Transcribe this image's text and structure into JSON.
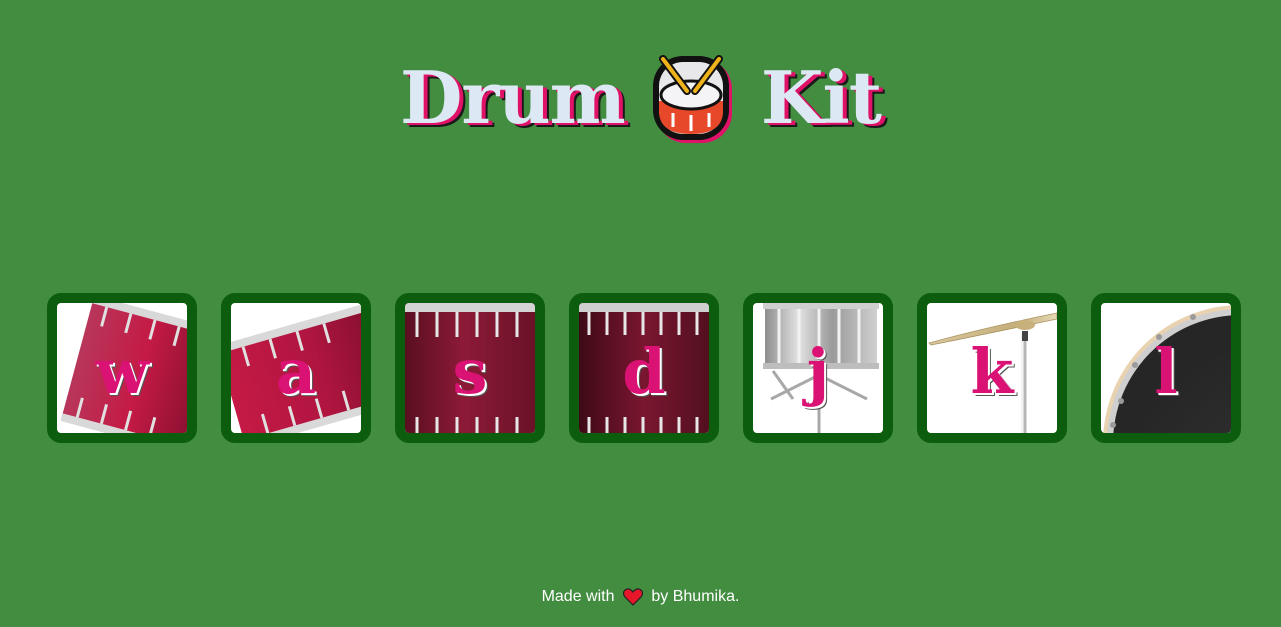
{
  "title": {
    "word1": "Drum",
    "word2": "Kit",
    "emoji_icon": "drum-with-drumsticks-icon"
  },
  "drums": [
    {
      "key": "w",
      "instrument_icon": "tom-1-drum-icon"
    },
    {
      "key": "a",
      "instrument_icon": "tom-2-drum-icon"
    },
    {
      "key": "s",
      "instrument_icon": "tom-3-drum-icon"
    },
    {
      "key": "d",
      "instrument_icon": "tom-4-drum-icon"
    },
    {
      "key": "j",
      "instrument_icon": "snare-drum-icon"
    },
    {
      "key": "k",
      "instrument_icon": "crash-cymbal-icon"
    },
    {
      "key": "l",
      "instrument_icon": "kick-drum-icon"
    }
  ],
  "footer": {
    "prefix": "Made with",
    "heart_icon": "heart-icon",
    "suffix": "by Bhumika."
  },
  "colors": {
    "background": "#438d41",
    "button_border": "#0c5d0e",
    "key_letter": "#da1273",
    "title_text": "#dce8f4",
    "title_shadow": "#e01268"
  }
}
